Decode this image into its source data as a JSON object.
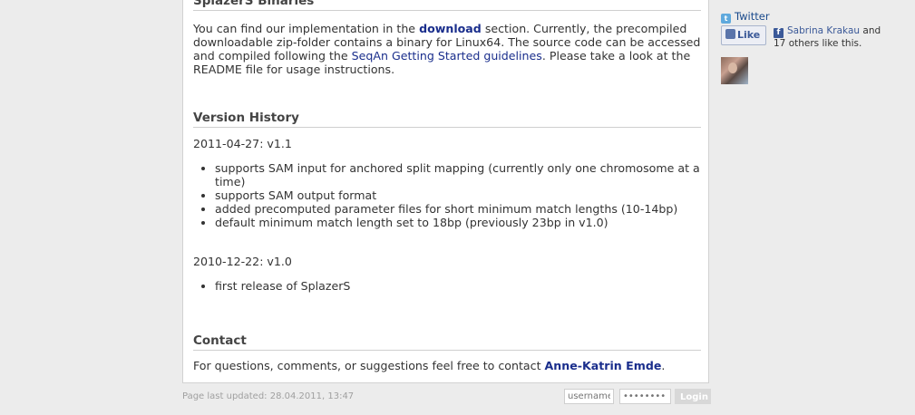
{
  "binaries": {
    "title": "SplazerS Binaries",
    "p1_a": "You can find our implementation in the ",
    "download_link": "download",
    "p1_b": " section. Currently, the precompiled downloadable zip-folder contains a binary for Linux64. The source code can be accessed and compiled following the ",
    "seqan_link": "SeqAn Getting Started guidelines",
    "p1_c": ". Please take a look at the README file for usage instructions."
  },
  "version_history": {
    "title": "Version History",
    "v11_heading": "2011-04-27: v1.1",
    "v11_items": [
      "supports SAM input for anchored split mapping (currently only one chromosome at a time)",
      "supports SAM output format",
      "added precomputed parameter files for short minimum match lengths (10-14bp)",
      "default minimum match length set to 18bp (previously 23bp in v1.0)"
    ],
    "v10_heading": "2010-12-22: v1.0",
    "v10_items": [
      "first release of SplazerS"
    ]
  },
  "contact": {
    "title": "Contact",
    "text_a": "For questions, comments, or suggestions feel free to contact ",
    "author_link": "Anne-Katrin Emde",
    "text_b": "."
  },
  "footer": {
    "updated": "Page last updated: 28.04.2011, 13:47",
    "username_placeholder": "username",
    "password_placeholder": "••••••••",
    "login_label": "Login"
  },
  "sidebar": {
    "twitter_label": "Twitter",
    "like_label": "Like",
    "fb_name": "Sabrina Krakau",
    "fb_text_a": " and",
    "fb_text_b": "17 others like this."
  },
  "colors": {
    "link": "#1a2e8c",
    "background": "#ececec",
    "facebook": "#3b5998"
  }
}
